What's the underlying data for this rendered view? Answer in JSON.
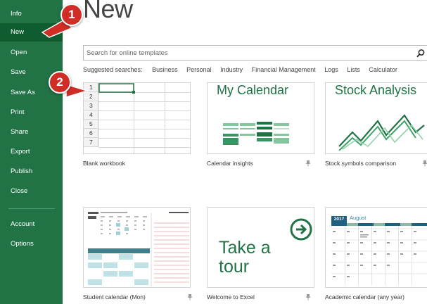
{
  "sidebar": {
    "items": [
      {
        "label": "Info"
      },
      {
        "label": "New",
        "selected": true
      },
      {
        "label": "Open"
      },
      {
        "label": "Save"
      },
      {
        "label": "Save As"
      },
      {
        "label": "Print"
      },
      {
        "label": "Share"
      },
      {
        "label": "Export"
      },
      {
        "label": "Publish"
      },
      {
        "label": "Close"
      }
    ],
    "bottom_items": [
      {
        "label": "Account"
      },
      {
        "label": "Options"
      }
    ]
  },
  "callouts": [
    "1",
    "2"
  ],
  "main": {
    "title": "New",
    "search": {
      "placeholder": "Search for online templates",
      "value": ""
    },
    "suggested": {
      "label": "Suggested searches:",
      "links": [
        "Business",
        "Personal",
        "Industry",
        "Financial Management",
        "Logs",
        "Lists",
        "Calculator"
      ]
    },
    "templates": [
      {
        "name": "Blank workbook",
        "row_numbers": [
          "1",
          "2",
          "3",
          "4",
          "5",
          "6",
          "7"
        ]
      },
      {
        "name": "Calendar insights",
        "preview_title": "My Calendar"
      },
      {
        "name": "Stock symbols comparison",
        "preview_title": "Stock Analysis"
      },
      {
        "name": "Student calendar (Mon)"
      },
      {
        "name": "Welcome to Excel",
        "preview_line1": "Take a",
        "preview_line2": "tour"
      },
      {
        "name": "Academic calendar (any year)",
        "preview_year": "2017",
        "preview_month": "August"
      }
    ]
  },
  "colors": {
    "sidebar_bg": "#217346",
    "sidebar_selected": "#0e5c30",
    "accent_green": "#217346",
    "callout_red": "#d12d27"
  }
}
